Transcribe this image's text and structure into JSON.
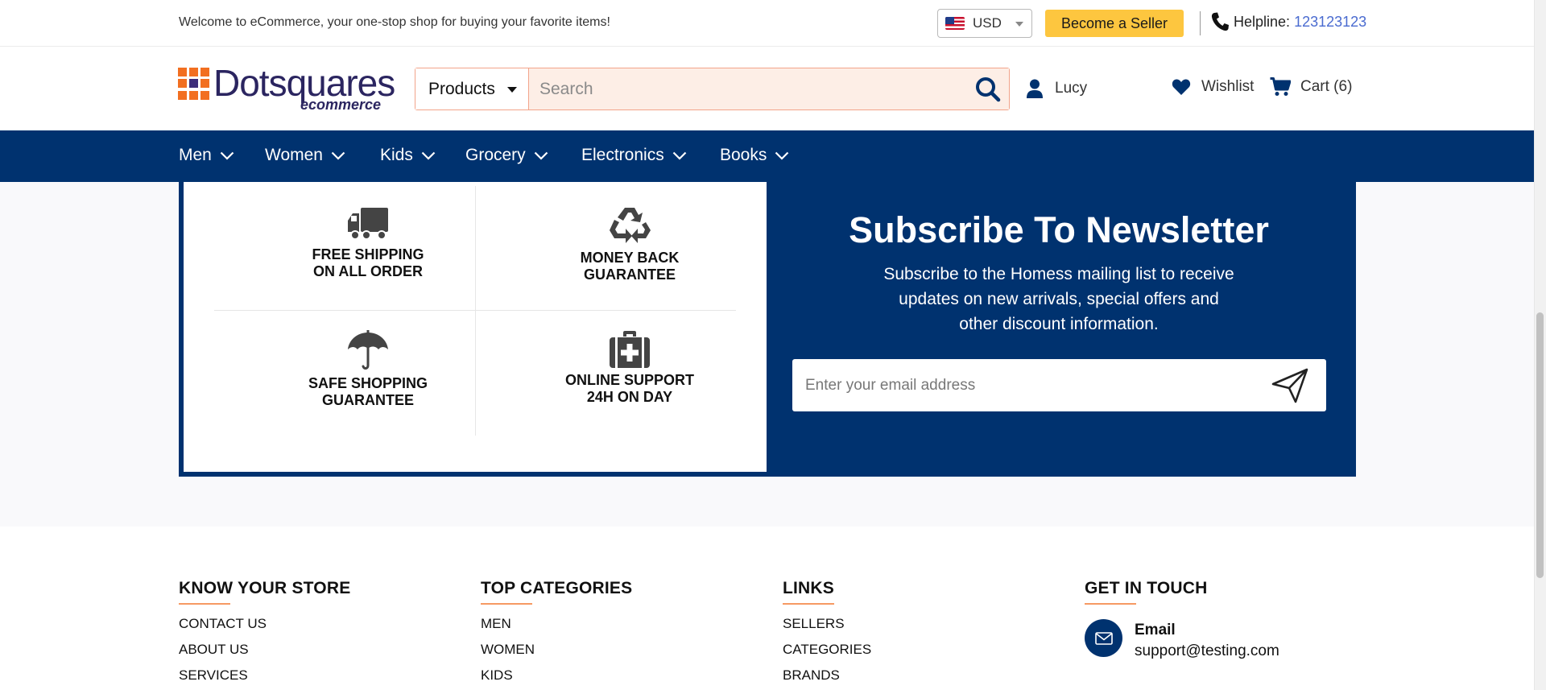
{
  "topbar": {
    "welcome": "Welcome to eCommerce, your one-stop shop for buying your favorite items!",
    "currency": "USD",
    "become_seller": "Become a Seller",
    "helpline_label": "Helpline:",
    "helpline_number": "123123123"
  },
  "header": {
    "logo_text": "Dotsquares",
    "logo_sub": "ecommerce",
    "search_category": "Products",
    "search_placeholder": "Search",
    "user_name": "Lucy",
    "wishlist": "Wishlist",
    "cart": "Cart (6)"
  },
  "nav": {
    "items": [
      {
        "label": "Men"
      },
      {
        "label": "Women"
      },
      {
        "label": "Kids"
      },
      {
        "label": "Grocery"
      },
      {
        "label": "Electronics"
      },
      {
        "label": "Books"
      }
    ]
  },
  "features": [
    {
      "line1": "FREE SHIPPING",
      "line2": "ON ALL ORDER",
      "icon": "truck-icon"
    },
    {
      "line1": "MONEY BACK",
      "line2": "GUARANTEE",
      "icon": "recycle-icon"
    },
    {
      "line1": "SAFE SHOPPING",
      "line2": "GUARANTEE",
      "icon": "umbrella-icon"
    },
    {
      "line1": "ONLINE SUPPORT",
      "line2": "24H ON DAY",
      "icon": "first-aid-icon"
    }
  ],
  "newsletter": {
    "title": "Subscribe To Newsletter",
    "desc_line1": "Subscribe to the Homess mailing list to receive",
    "desc_line2": "updates on new arrivals, special offers and",
    "desc_line3": "other discount information.",
    "email_placeholder": "Enter your email address"
  },
  "footer": {
    "know_title": "KNOW YOUR STORE",
    "know_links": [
      "CONTACT US",
      "ABOUT US",
      "SERVICES"
    ],
    "cat_title": "TOP CATEGORIES",
    "cat_links": [
      "MEN",
      "WOMEN",
      "KIDS"
    ],
    "links_title": "LINKS",
    "links_links": [
      "SELLERS",
      "CATEGORIES",
      "BRANDS"
    ],
    "touch_title": "GET IN TOUCH",
    "email_label": "Email",
    "email_value": "support@testing.com"
  },
  "colors": {
    "primary": "#00326f",
    "accent": "#f26f21",
    "seller_button": "#fdc63f",
    "helpline_link": "#4a6bd0"
  }
}
